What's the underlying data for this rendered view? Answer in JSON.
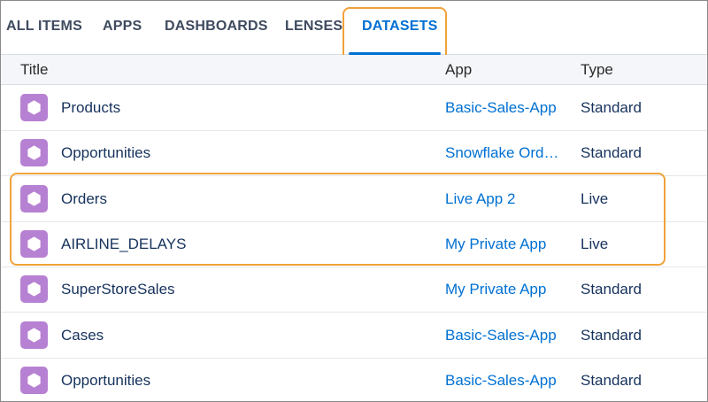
{
  "tabs": [
    {
      "label": "ALL ITEMS",
      "active": false
    },
    {
      "label": "APPS",
      "active": false
    },
    {
      "label": "DASHBOARDS",
      "active": false
    },
    {
      "label": "LENSES",
      "active": false
    },
    {
      "label": "DATASETS",
      "active": true
    }
  ],
  "table": {
    "columns": {
      "title": "Title",
      "app": "App",
      "type": "Type"
    },
    "rows": [
      {
        "title": "Products",
        "app": "Basic-Sales-App",
        "type": "Standard",
        "icon": "dataset-icon"
      },
      {
        "title": "Opportunities",
        "app": "Snowflake Ord…",
        "type": "Standard",
        "icon": "dataset-icon"
      },
      {
        "title": "Orders",
        "app": "Live App 2",
        "type": "Live",
        "icon": "dataset-icon"
      },
      {
        "title": "AIRLINE_DELAYS",
        "app": "My Private App",
        "type": "Live",
        "icon": "dataset-icon"
      },
      {
        "title": "SuperStoreSales",
        "app": "My Private App",
        "type": "Standard",
        "icon": "dataset-icon"
      },
      {
        "title": "Cases",
        "app": "Basic-Sales-App",
        "type": "Standard",
        "icon": "dataset-icon"
      },
      {
        "title": "Opportunities",
        "app": "Basic-Sales-App",
        "type": "Standard",
        "icon": "dataset-icon"
      }
    ]
  },
  "colors": {
    "accent": "#0070d2",
    "highlight": "#f0a23a",
    "dataset_icon": "#b781d3"
  }
}
